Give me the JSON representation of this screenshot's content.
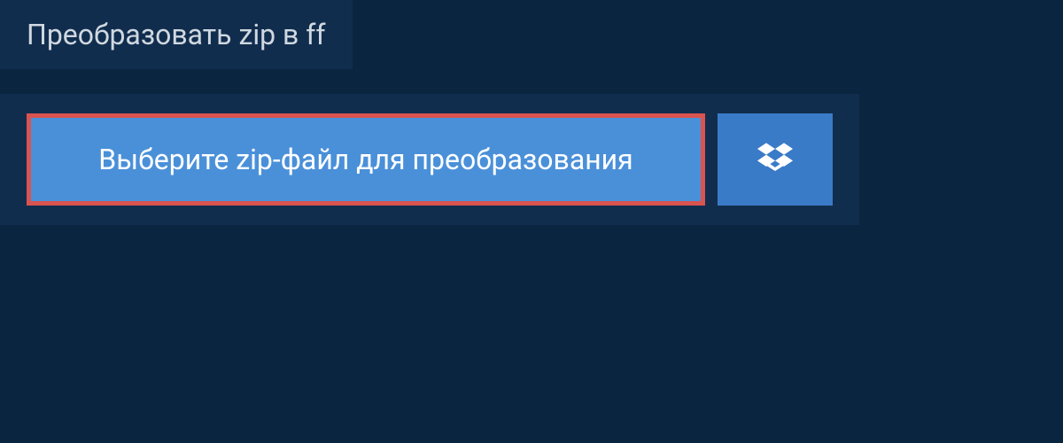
{
  "header": {
    "title": "Преобразовать zip в ff"
  },
  "upload": {
    "select_button_label": "Выберите zip-файл для преобразования",
    "dropbox_icon": "dropbox"
  },
  "colors": {
    "background": "#0a2540",
    "panel": "#112d4e",
    "button_primary": "#4a90d9",
    "button_secondary": "#3a7bc8",
    "highlight_border": "#d9534f",
    "text_light": "#d0d8e0",
    "text_white": "#ffffff"
  }
}
